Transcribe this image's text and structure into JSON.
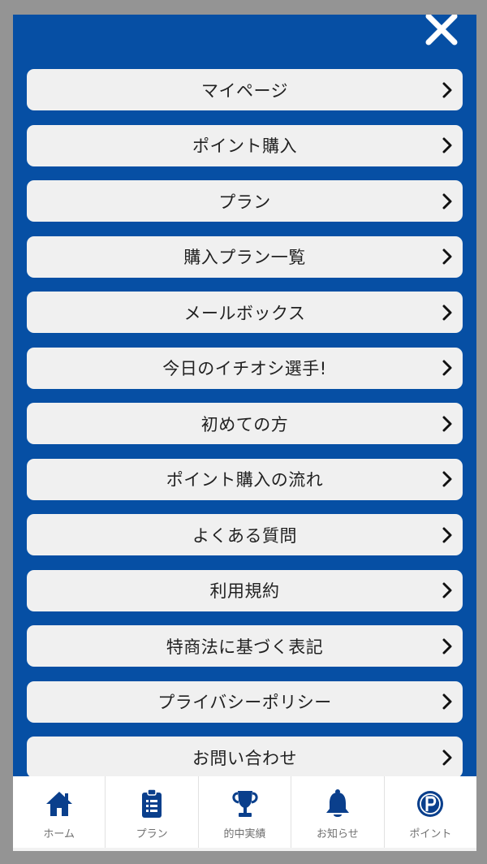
{
  "menu": {
    "items": [
      {
        "label": "マイページ"
      },
      {
        "label": "ポイント購入"
      },
      {
        "label": "プラン"
      },
      {
        "label": "購入プラン一覧"
      },
      {
        "label": "メールボックス"
      },
      {
        "label": "今日のイチオシ選手!"
      },
      {
        "label": "初めての方"
      },
      {
        "label": "ポイント購入の流れ"
      },
      {
        "label": "よくある質問"
      },
      {
        "label": "利用規約"
      },
      {
        "label": "特商法に基づく表記"
      },
      {
        "label": "プライバシーポリシー"
      },
      {
        "label": "お問い合わせ"
      }
    ]
  },
  "tabbar": {
    "tabs": [
      {
        "label": "ホーム",
        "icon": "home-icon"
      },
      {
        "label": "プラン",
        "icon": "clipboard-icon"
      },
      {
        "label": "的中実績",
        "icon": "trophy-icon"
      },
      {
        "label": "お知らせ",
        "icon": "bell-icon"
      },
      {
        "label": "ポイント",
        "icon": "point-icon"
      }
    ]
  },
  "colors": {
    "panel_blue": "#064fa4",
    "button_bg": "#f0f0f0",
    "outer_gray": "#949494",
    "icon_navy": "#0a3f8c"
  }
}
